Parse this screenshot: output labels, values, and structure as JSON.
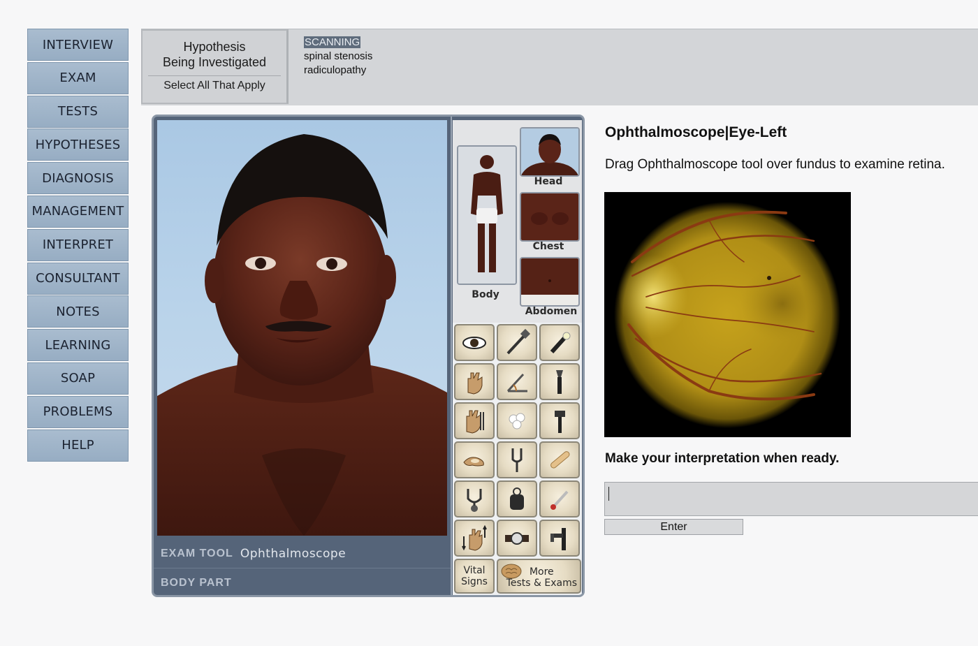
{
  "nav": {
    "items": [
      {
        "label": "INTERVIEW"
      },
      {
        "label": "EXAM"
      },
      {
        "label": "TESTS"
      },
      {
        "label": "HYPOTHESES"
      },
      {
        "label": "DIAGNOSIS"
      },
      {
        "label": "MANAGEMENT"
      },
      {
        "label": "INTERPRET"
      },
      {
        "label": "CONSULTANT"
      },
      {
        "label": "NOTES"
      },
      {
        "label": "LEARNING"
      },
      {
        "label": "SOAP"
      },
      {
        "label": "PROBLEMS"
      },
      {
        "label": "HELP"
      }
    ]
  },
  "hypothesis": {
    "title_line1": "Hypothesis",
    "title_line2": "Being Investigated",
    "subtitle": "Select All That Apply",
    "items": [
      "SCANNING",
      "spinal stenosis",
      "radiculopathy"
    ]
  },
  "exam": {
    "tool_label": "EXAM TOOL",
    "tool_value": "Ophthalmoscope",
    "body_part_label": "BODY PART",
    "body_part_value": "",
    "regions": {
      "body": "Body",
      "head": "Head",
      "chest": "Chest",
      "abdomen": "Abdomen"
    },
    "tools": [
      "eye-icon",
      "reflex-hammer-icon",
      "penlight-icon",
      "palpation-hand-icon",
      "goniometer-icon",
      "otoscope-icon",
      "percussion-hand-icon",
      "cotton-ball-icon",
      "tuning-hammer-icon",
      "smell-icon",
      "tuning-fork-icon",
      "tongue-depressor-icon",
      "stethoscope-icon",
      "blood-pressure-cuff-icon",
      "thermometer-icon",
      "strength-hand-icon",
      "watch-icon",
      "ophthalmoscope-icon"
    ],
    "vital_signs_line1": "Vital",
    "vital_signs_line2": "Signs",
    "more_tests_line1": "More",
    "more_tests_line2": "Tests & Exams"
  },
  "finding": {
    "title": "Ophthalmoscope|Eye-Left",
    "instruction": "Drag Ophthalmoscope tool over fundus to examine retina.",
    "prompt": "Make your interpretation when ready.",
    "answer_value": "",
    "enter_label": "Enter"
  },
  "colors": {
    "nav_bg": "#9fb3c9",
    "panel_bg": "#556479",
    "fundus": "#c9a21e"
  }
}
